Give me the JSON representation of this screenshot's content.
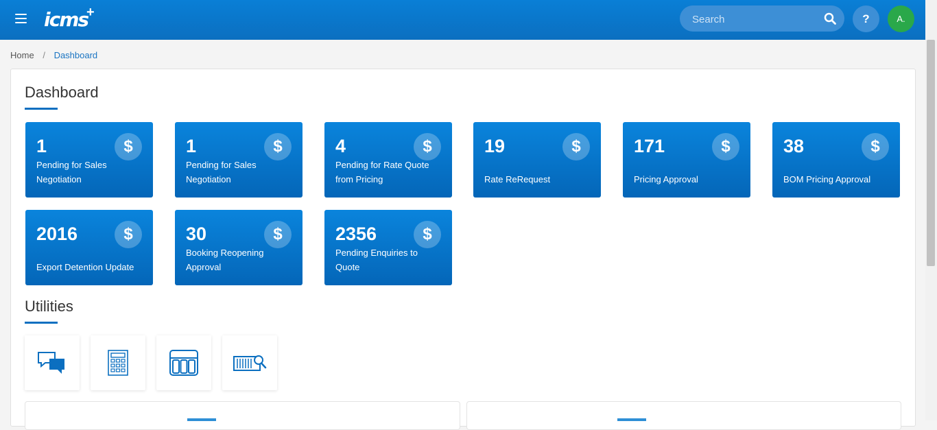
{
  "header": {
    "logo_text": "icms",
    "logo_plus": "+",
    "search_placeholder": "Search",
    "help_label": "?",
    "avatar_initials": "A."
  },
  "breadcrumb": {
    "home": "Home",
    "separator": "/",
    "current": "Dashboard"
  },
  "dashboard": {
    "title": "Dashboard",
    "cards": [
      {
        "count": "1",
        "label": "Pending for Sales Negotiation",
        "icon": "dollar-icon"
      },
      {
        "count": "1",
        "label": "Pending for Sales Negotiation",
        "icon": "dollar-icon"
      },
      {
        "count": "4",
        "label": "Pending for Rate Quote from Pricing",
        "icon": "dollar-icon"
      },
      {
        "count": "19",
        "label": "Rate ReRequest",
        "icon": "dollar-icon"
      },
      {
        "count": "171",
        "label": "Pricing Approval",
        "icon": "dollar-icon"
      },
      {
        "count": "38",
        "label": "BOM Pricing Approval",
        "icon": "dollar-icon"
      },
      {
        "count": "2016",
        "label": "Export Detention Update",
        "icon": "dollar-icon"
      },
      {
        "count": "30",
        "label": "Booking Reopening Approval",
        "icon": "dollar-icon"
      },
      {
        "count": "2356",
        "label": "Pending Enquiries to Quote",
        "icon": "dollar-icon"
      }
    ],
    "dollar_symbol": "$"
  },
  "utilities": {
    "title": "Utilities",
    "items": [
      {
        "icon": "chat-icon"
      },
      {
        "icon": "calculator-icon"
      },
      {
        "icon": "layout-icon"
      },
      {
        "icon": "container-search-icon"
      }
    ]
  },
  "colors": {
    "header_blue": "#0b6fc0",
    "card_blue": "#0a84dc",
    "avatar_green": "#2aa84a"
  }
}
